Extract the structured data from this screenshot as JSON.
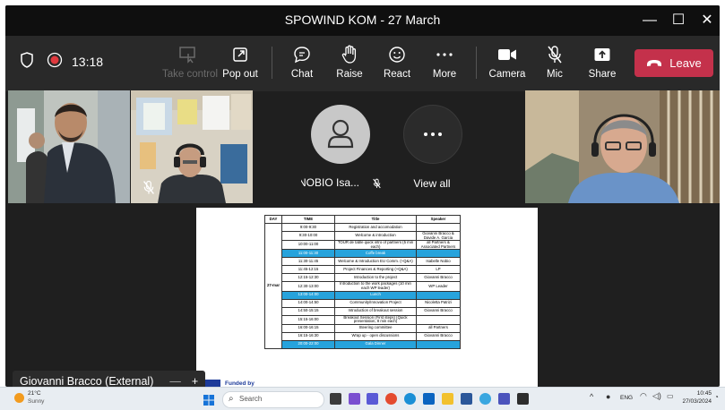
{
  "window": {
    "title": "SPOWIND KOM - 27 March",
    "controls": {
      "minimize": "—",
      "maximize": "☐",
      "close": "✕"
    }
  },
  "toolbar": {
    "timer": "13:18",
    "take_control": "Take control",
    "pop_out": "Pop out",
    "chat": "Chat",
    "raise": "Raise",
    "react": "React",
    "more": "More",
    "camera": "Camera",
    "mic": "Mic",
    "share": "Share",
    "leave": "Leave"
  },
  "participants": {
    "nobio": "NOBIO Isa...",
    "view_all": "View all",
    "presenter": "Giovanni Bracco (External)"
  },
  "document": {
    "funded_by": "Funded by",
    "headers": {
      "day": "DAY",
      "time": "TIME",
      "title": "Title",
      "speaker": "Speaker"
    },
    "day": "27-mar",
    "rows": [
      {
        "time": "9:00-9:30",
        "title": "Registration and accomodation",
        "speaker": ""
      },
      {
        "time": "9:30-10:00",
        "title": "Welcome & introduction",
        "speaker": "Giovanni Bracco & Davide A. Garcia"
      },
      {
        "time": "10:00-11:00",
        "title": "TOUR de table quick intro of partners (5 min each)",
        "speaker": "all Partners & Associated Partners"
      },
      {
        "time": "11:00-11:30",
        "title": "Coffe break",
        "speaker": ""
      },
      {
        "time": "11:30-11:45",
        "title": "Welcome & Introduction EU Comm. (+Q&A)",
        "speaker": "Isabelle Nobio"
      },
      {
        "time": "11:45-12:15",
        "title": "Project Finances & Reporting (+Q&A)",
        "speaker": "LP"
      },
      {
        "time": "12:15-12:30",
        "title": "Introduction to the project",
        "speaker": "Giovanni Bracco"
      },
      {
        "time": "12:30-13:00",
        "title": "Introduction to the work packages (10 min each WP leader)",
        "speaker": "WP Leader"
      },
      {
        "time": "13:00-14:00",
        "title": "Lunch",
        "speaker": ""
      },
      {
        "time": "14:00-14:50",
        "title": "Community/Innovation Project",
        "speaker": "Nicoletta Patrizi"
      },
      {
        "time": "14:50-15:15",
        "title": "Introduction of breakout session",
        "speaker": "Giovanni Bracco"
      },
      {
        "time": "15:15-16:00",
        "title": "Breakout Session (First steps) (Quick presentation, 8 min each)",
        "speaker": ""
      },
      {
        "time": "16:00-16:15",
        "title": "Steering committee",
        "speaker": "all Partners"
      },
      {
        "time": "16:15-16:30",
        "title": "Wrap up - open discussions",
        "speaker": "Giovanni Bracco"
      },
      {
        "time": "20:00-22:00",
        "title": "Gala Dinner",
        "speaker": ""
      }
    ]
  },
  "taskbar": {
    "weather_temp": "21°C",
    "weather_desc": "Sunny",
    "search_placeholder": "Search",
    "lang": "ENG",
    "time": "10:45",
    "date": "27/03/2024"
  },
  "colors": {
    "leave": "#c4314b",
    "highlight_row": "#27a3dc",
    "record": "#e0393e"
  }
}
